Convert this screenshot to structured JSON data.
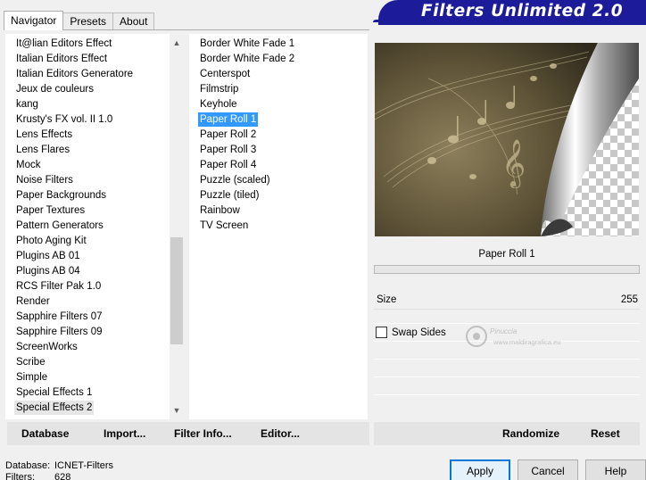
{
  "tabs": [
    {
      "label": "Navigator",
      "active": true
    },
    {
      "label": "Presets",
      "active": false
    },
    {
      "label": "About",
      "active": false
    }
  ],
  "banner": {
    "title": "Filters Unlimited 2.0",
    "color": "#1c1c9a"
  },
  "categories": [
    "It@lian Editors Effect",
    "Italian Editors Effect",
    "Italian Editors Generatore",
    "Jeux de couleurs",
    "kang",
    "Krusty's FX vol. II 1.0",
    "Lens Effects",
    "Lens Flares",
    "Mock",
    "Noise Filters",
    "Paper Backgrounds",
    "Paper Textures",
    "Pattern Generators",
    "Photo Aging Kit",
    "Plugins AB 01",
    "Plugins AB 04",
    "RCS Filter Pak 1.0",
    "Render",
    "Sapphire Filters 07",
    "Sapphire Filters 09",
    "ScreenWorks",
    "Scribe",
    "Simple",
    "Special Effects 1",
    "Special Effects 2"
  ],
  "selected_category": "Special Effects 2",
  "filters": [
    "Border White Fade 1",
    "Border White Fade 2",
    "Centerspot",
    "Filmstrip",
    "Keyhole",
    "Paper Roll 1",
    "Paper Roll 2",
    "Paper Roll 3",
    "Paper Roll 4",
    "Puzzle (scaled)",
    "Puzzle (tiled)",
    "Rainbow",
    "TV Screen"
  ],
  "selected_filter": "Paper Roll 1",
  "selection_color": "#3399ff",
  "preview": {
    "selected_filter_title": "Paper Roll 1"
  },
  "params": {
    "size_label": "Size",
    "size_value": "255",
    "swap_label": "Swap Sides",
    "swap_checked": false
  },
  "watermark": {
    "line1": "Pinuccia",
    "line2": "www.maldiragrafica.eu"
  },
  "left_buttons": [
    "Database",
    "Import...",
    "Filter Info...",
    "Editor..."
  ],
  "right_buttons": [
    "Randomize",
    "Reset"
  ],
  "status": {
    "database_label": "Database:",
    "database_value": "ICNET-Filters",
    "filters_label": "Filters:",
    "filters_value": "628"
  },
  "dialog_buttons": {
    "apply": "Apply",
    "cancel": "Cancel",
    "help": "Help"
  }
}
